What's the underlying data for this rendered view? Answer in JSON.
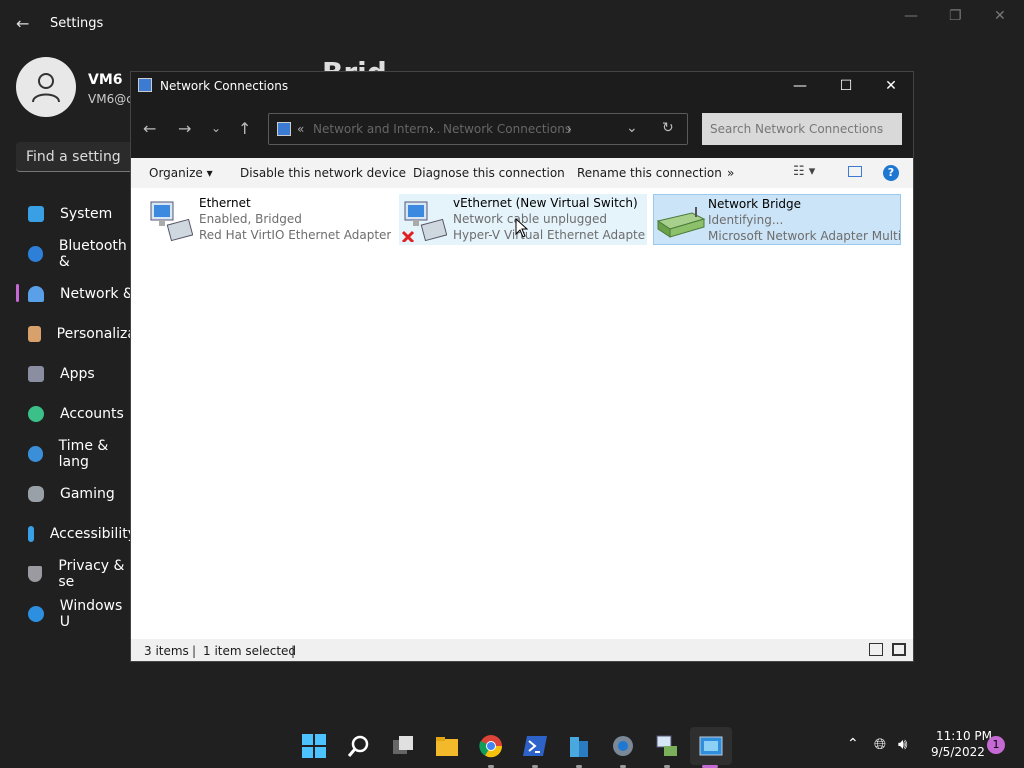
{
  "settings": {
    "title": "Settings",
    "user_name": "VM6",
    "user_email": "VM6@c",
    "bg_heading": "Brid",
    "find_placeholder": "Find a setting",
    "nav": [
      {
        "label": "System",
        "color": "#3aa0e6"
      },
      {
        "label": "Bluetooth &",
        "color": "#2d7fd8"
      },
      {
        "label": "Network &",
        "color": "#5aa0e8"
      },
      {
        "label": "Personaliza",
        "color": "#d8a06a"
      },
      {
        "label": "Apps",
        "color": "#8a8ea0"
      },
      {
        "label": "Accounts",
        "color": "#3cc08a"
      },
      {
        "label": "Time & lang",
        "color": "#3a8fd8"
      },
      {
        "label": "Gaming",
        "color": "#9aa0a8"
      },
      {
        "label": "Accessibility",
        "color": "#3aa0e6"
      },
      {
        "label": "Privacy & se",
        "color": "#9a9aa0"
      },
      {
        "label": "Windows U",
        "color": "#2d8fe0"
      }
    ]
  },
  "window": {
    "title": "Network Connections",
    "breadcrumb": [
      "«",
      "Network and Intern...",
      "›",
      "Network Connections",
      "›"
    ],
    "search_placeholder": "Search Network Connections",
    "commands": [
      "Organize ▾",
      "Disable this network device",
      "Diagnose this connection",
      "Rename this connection",
      "»"
    ],
    "items": [
      {
        "name": "Ethernet",
        "status": "Enabled, Bridged",
        "adapter": "Red Hat VirtIO Ethernet Adapter"
      },
      {
        "name": "vEthernet (New Virtual Switch)",
        "status": "Network cable unplugged",
        "adapter": "Hyper-V Virtual Ethernet Adapter ..."
      },
      {
        "name": "Network Bridge",
        "status": "Identifying...",
        "adapter": "Microsoft Network Adapter Multi..."
      }
    ],
    "status": {
      "count": "3 items",
      "selected": "1 item selected"
    }
  },
  "taskbar": {
    "time": "11:10 PM",
    "date": "9/5/2022",
    "notifications": "1",
    "apps": [
      "start",
      "search",
      "task-view",
      "file-explorer",
      "chrome",
      "powershell",
      "app-building",
      "settings",
      "network-tool",
      "network-connections"
    ]
  }
}
